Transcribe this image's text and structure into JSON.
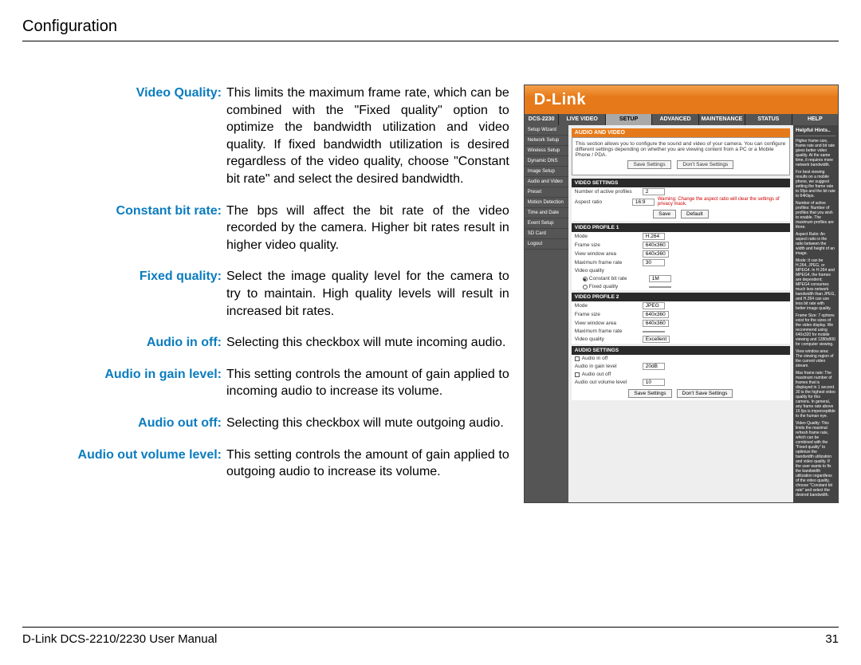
{
  "header": {
    "title": "Configuration"
  },
  "defs": [
    {
      "label": "Video Quality:",
      "text": "This limits the maximum frame rate, which can be combined with the \"Fixed quality\" option to optimize the bandwidth utilization and video quality. If fixed bandwidth utilization is desired regardless of the video quality, choose \"Constant bit rate\" and select the desired bandwidth."
    },
    {
      "label": "Constant bit rate:",
      "text": "The bps will affect the bit rate of the video recorded by the camera. Higher bit rates result in higher video quality."
    },
    {
      "label": "Fixed quality:",
      "text": "Select the image quality level for the camera to try to maintain. High quality levels will result in increased bit rates."
    },
    {
      "label": "Audio in off:",
      "text": "Selecting this checkbox will mute incoming audio."
    },
    {
      "label": "Audio in gain level:",
      "text": "This setting controls the amount of gain applied to incoming audio to increase its volume."
    },
    {
      "label": "Audio out off:",
      "text": "Selecting this checkbox will mute outgoing audio."
    },
    {
      "label": "Audio out volume level:",
      "text": "This setting controls the amount of gain applied to outgoing audio to increase its volume."
    }
  ],
  "ui": {
    "brand": "D-Link",
    "model": "DCS-2230",
    "tabs": [
      "LIVE VIDEO",
      "SETUP",
      "ADVANCED",
      "MAINTENANCE",
      "STATUS",
      "HELP"
    ],
    "active_tab": "SETUP",
    "sidebar": [
      "Setup Wizard",
      "Network Setup",
      "Wireless Setup",
      "Dynamic DNS",
      "Image Setup",
      "Audio and Video",
      "Preset",
      "Motion Detection",
      "Time and Date",
      "Event Setup",
      "SD Card",
      "Logout"
    ],
    "section": {
      "title": "AUDIO AND VIDEO",
      "desc": "This section allows you to configure the sound and video of your camera. You can configure different settings depending on whether you are viewing content from a PC or a Mobile Phone / PDA.",
      "save": "Save Settings",
      "dont": "Don't Save Settings"
    },
    "video_settings": {
      "title": "VIDEO SETTINGS",
      "rows": [
        {
          "label": "Number of active profiles",
          "val": "2"
        },
        {
          "label": "Aspect ratio",
          "val": "16:9",
          "warn": "Warning: Change the aspect ratio will clear the settings of privacy mask."
        }
      ],
      "btns": [
        "Save",
        "Default"
      ]
    },
    "profile1": {
      "title": "VIDEO PROFILE 1",
      "rows": [
        {
          "label": "Mode",
          "val": "H.264"
        },
        {
          "label": "Frame size",
          "val": "640x360"
        },
        {
          "label": "View window area",
          "val": "640x360"
        },
        {
          "label": "Maximum frame rate",
          "val": "30"
        },
        {
          "label": "Video quality",
          "val": ""
        },
        {
          "label": "Constant bit rate",
          "val": "1M",
          "radio": true,
          "sel": true
        },
        {
          "label": "Fixed quality",
          "val": "",
          "radio": true
        }
      ]
    },
    "profile2": {
      "title": "VIDEO PROFILE 2",
      "rows": [
        {
          "label": "Mode",
          "val": "JPEG"
        },
        {
          "label": "Frame size",
          "val": "640x360"
        },
        {
          "label": "View window area",
          "val": "640x360"
        },
        {
          "label": "Maximum frame rate",
          "val": ""
        },
        {
          "label": "Video quality",
          "val": "Excellent"
        }
      ]
    },
    "audio": {
      "title": "AUDIO SETTINGS",
      "rows": [
        {
          "label": "Audio in off",
          "chk": true
        },
        {
          "label": "Audio in gain level",
          "val": "20dB"
        },
        {
          "label": "Audio out off",
          "chk": true
        },
        {
          "label": "Audio out volume level",
          "val": "10"
        }
      ]
    },
    "hints": {
      "title": "Helpful Hints..",
      "body": [
        "Higher frame size, frame rate and bit rate gives better video quality. At the same time, it requires more network bandwidth.",
        "For best viewing results on a mobile phone, we suggest setting the frame rate to 5fps and the bit rate to 64Kbps.",
        "Number of active profiles: Number of profiles that you wish to enable. The maximum profiles are three.",
        "Aspect Ratio: An aspect ratio is the ratio between the width and height of an image.",
        "Mode: It can be H.264, JPEG, or MPEG4. In H.264 and MPEG4, the frames are dependent; MPEG4 consumes much less network bandwidth than JPEG, and H.264 can use less bit rate with better image quality.",
        "Frame Size: 7 options exist for the sizes of the video display. We recommend using 640x320 for mobile viewing and 1280x800 for computer viewing.",
        "View window area: The viewing region of the current video stream.",
        "Max frame rate: The maximum number of frames that is displayed in 1 second. 30 is the highest video quality for this camera. In general, any frame rate above 15 fps is imperceptible to the human eye.",
        "Video Quality: This limits the maximal refresh frame rate, which can be combined with the \"Fixed quality\" to optimize the bandwidth utilization and video quality. If the user wants to fix the bandwidth utilization regardless of the video quality, choose \"Constant bit rate\" and select the desired bandwidth."
      ]
    }
  },
  "footer": {
    "left": "D-Link DCS-2210/2230 User Manual",
    "right": "31"
  }
}
